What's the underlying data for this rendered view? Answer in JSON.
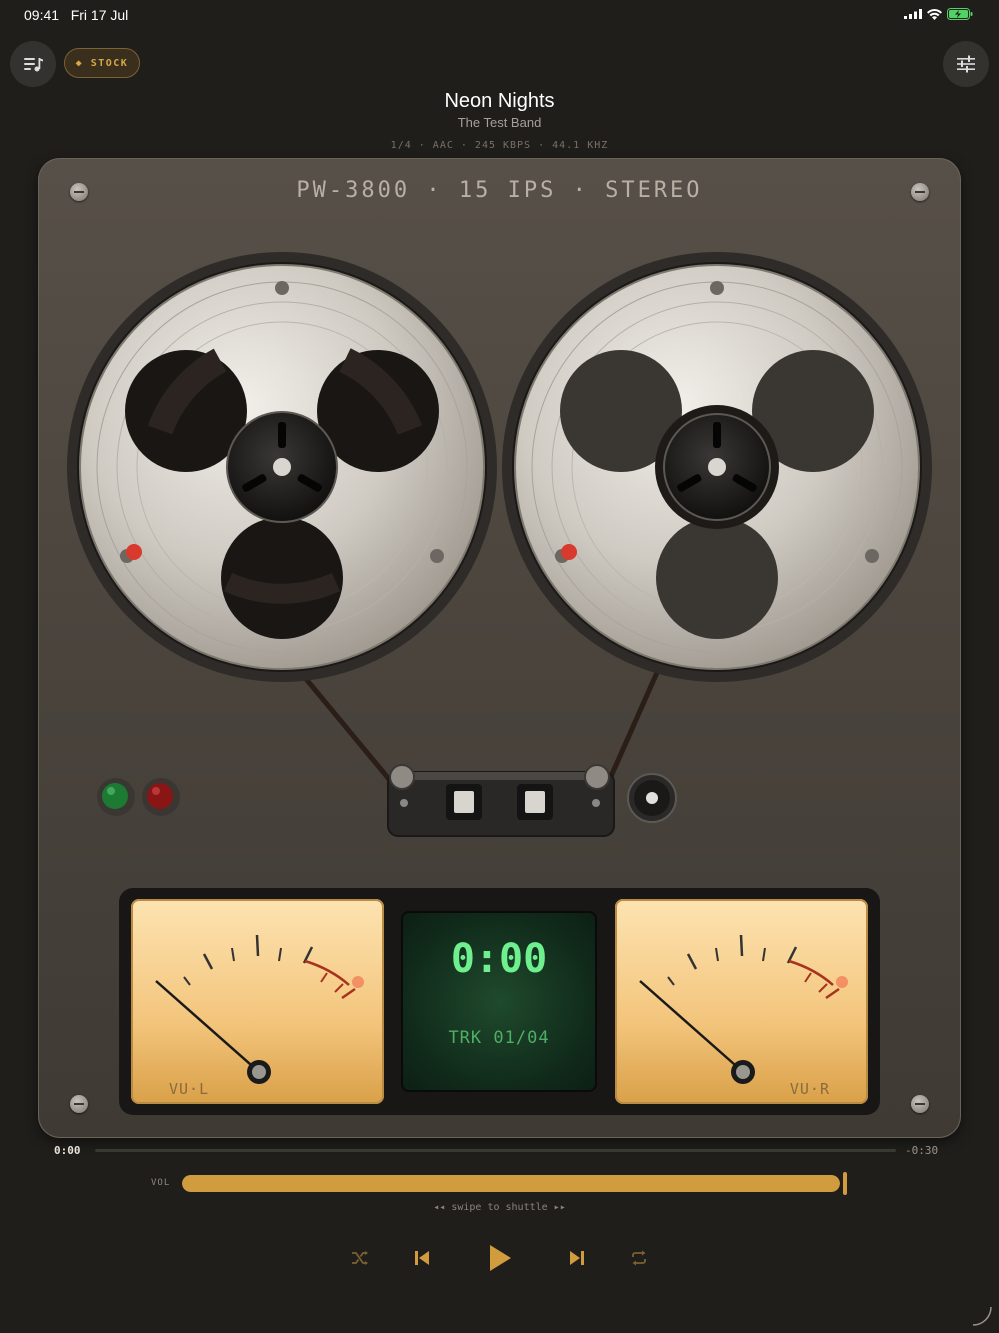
{
  "status_bar": {
    "time": "09:41",
    "date": "Fri 17 Jul"
  },
  "header": {
    "stock_label": "◆ STOCK",
    "track_title": "Neon Nights",
    "artist": "The Test Band",
    "meta": "1/4  ·  AAC · 245 KBPS · 44.1 KHZ"
  },
  "deck": {
    "label": "PW-3800 · 15 IPS · STEREO",
    "indicator_colors": {
      "power": "#1d7a32",
      "record": "#8a1515"
    }
  },
  "meters": {
    "left_label": "VU·L",
    "right_label": "VU·R",
    "lcd_time": "0:00",
    "lcd_track": "TRK 01/04"
  },
  "progress": {
    "elapsed": "0:00",
    "remaining": "-0:30",
    "fraction": 0.0
  },
  "volume": {
    "label": "VOL",
    "fraction": 1.0
  },
  "hint": "◂◂ swipe to shuttle ▸▸",
  "colors": {
    "accent": "#d09c3e",
    "lcd_text": "#6ff08e"
  }
}
